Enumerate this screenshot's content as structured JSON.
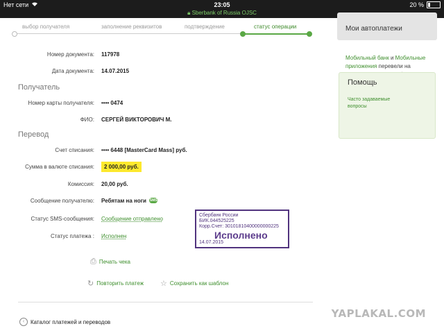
{
  "statusbar": {
    "carrier": "Нет сети",
    "time": "23:05",
    "url": "Sberbank of Russia  OJSC",
    "battery": "20 %"
  },
  "steps": [
    {
      "label": "выбор получателя"
    },
    {
      "label": "заполнение реквизитов"
    },
    {
      "label": "подтверждение"
    },
    {
      "label": "статус операции",
      "active": true
    }
  ],
  "doc": {
    "number_label": "Номер документа:",
    "number": "117978",
    "date_label": "Дата документа:",
    "date": "14.07.2015"
  },
  "recipient": {
    "section": "Получатель",
    "card_label": "Номер карты получателя:",
    "card": "•••• 0474",
    "name_label": "ФИО:",
    "name": "СЕРГЕЙ ВИКТОРОВИЧ М."
  },
  "transfer": {
    "section": "Перевод",
    "account_label": "Счет списания:",
    "account": "•••• 6448  [MasterCard Mass]  руб.",
    "amount_label": "Сумма в валюте списания:",
    "amount": "2 000,00  руб.",
    "fee_label": "Комиссия:",
    "fee": "20,00 руб.",
    "message_label": "Сообщение получателю:",
    "message": "Ребятам на ноги",
    "sms_label": "Статус SMS-сообщения:",
    "sms": "Сообщение отправлено",
    "status_label": "Статус платежа :",
    "status": "Исполнен",
    "sms_badge": "SMS"
  },
  "stamp": {
    "bank": "Сбербанк России",
    "bik": "БИК.044525225",
    "corr": "Корр.Счет: 30101810400000000225",
    "status": "Исполнено",
    "date": "14.07.2015"
  },
  "actions": {
    "print": "Печать чека",
    "repeat": "Повторить платеж",
    "save": "Сохранить как шаблон",
    "catalog": "Каталог платежей и переводов"
  },
  "sidebar": {
    "top_title": "Мои автоплатежи",
    "promo_link1": "Мобильный банк",
    "promo_and": " и ",
    "promo_link2": "Мобильные приложения",
    "promo_rest": " перевели на страницу вашего профиля",
    "help_title": "Помощь",
    "help_faq": "Часто задаваемые вопросы"
  },
  "watermark": "YAPLAKAL.COM",
  "colors": {
    "accent": "#3f8f2e",
    "highlight": "#fde92d",
    "stamp": "#51337e"
  }
}
